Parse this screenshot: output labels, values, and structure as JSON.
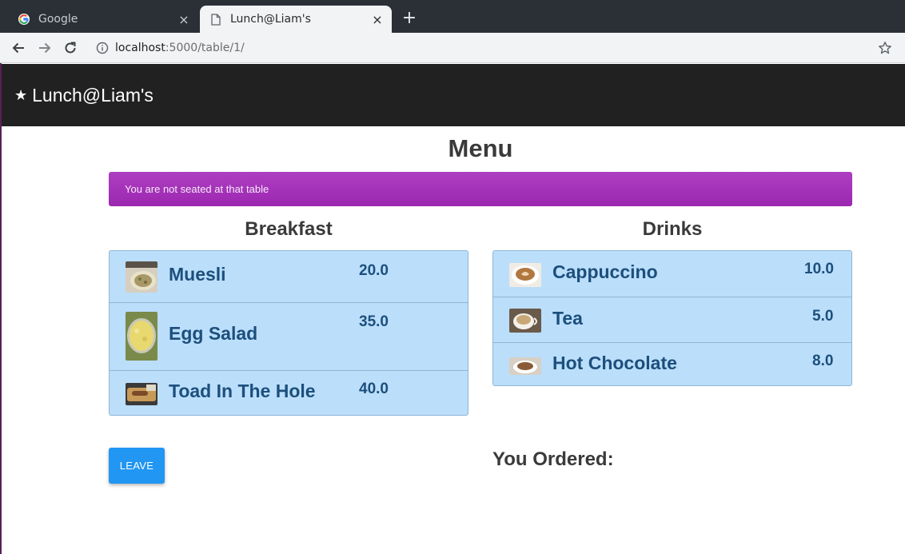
{
  "browser": {
    "tabs": [
      {
        "title": "Google",
        "active": false
      },
      {
        "title": "Lunch@Liam's",
        "active": true
      }
    ],
    "new_tab": "+",
    "close": "×",
    "url_host": "localhost",
    "url_path": ":5000/table/1/"
  },
  "navbar": {
    "star": "★",
    "brand": "Lunch@Liam's"
  },
  "page": {
    "title": "Menu",
    "alert": "You are not seated at that table",
    "alert_color": "#9c27b0"
  },
  "breakfast": {
    "title": "Breakfast",
    "items": [
      {
        "name": "Muesli",
        "price": "20.0"
      },
      {
        "name": "Egg Salad",
        "price": "35.0"
      },
      {
        "name": "Toad In The Hole",
        "price": "40.0"
      }
    ]
  },
  "drinks": {
    "title": "Drinks",
    "items": [
      {
        "name": "Cappuccino",
        "price": "10.0"
      },
      {
        "name": "Tea",
        "price": "5.0"
      },
      {
        "name": "Hot Chocolate",
        "price": "8.0"
      }
    ]
  },
  "actions": {
    "leave": "LEAVE",
    "leave_color": "#2196f3"
  },
  "order": {
    "title": "You Ordered:"
  }
}
